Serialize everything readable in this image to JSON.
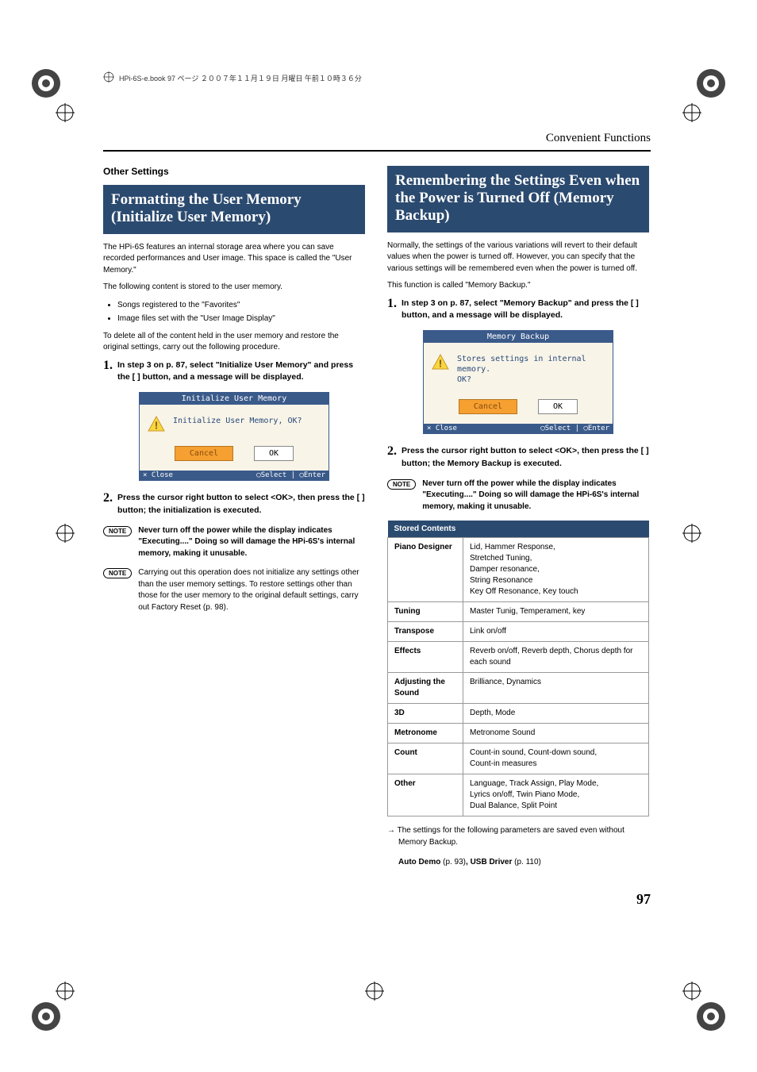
{
  "header_meta": "HPi-6S-e.book 97 ページ ２００７年１１月１９日 月曜日 午前１０時３６分",
  "breadcrumb": "Convenient Functions",
  "page_number": "97",
  "left": {
    "subheading": "Other Settings",
    "banner": "Formatting the User Memory (Initialize User Memory)",
    "p1": "The HPi-6S features an internal storage area where you can save recorded performances and User image. This space is called the \"User Memory.\"",
    "p2": "The following content is stored to the user memory.",
    "bullets": [
      "Songs registered to the \"Favorites\"",
      "Image files set with the \"User Image Display\""
    ],
    "p3": "To delete all of the content held in the user memory and restore the original settings, carry out the following procedure.",
    "step1": "In step 3 on p. 87, select \"Initialize User Memory\" and press the [     ] button, and a message will be displayed.",
    "screenshot": {
      "title": "Initialize User Memory",
      "msg": "Initialize User Memory, OK?",
      "cancel": "Cancel",
      "ok": "OK",
      "foot_left": "× Close",
      "foot_right": "◯Select | ◯Enter"
    },
    "step2": "Press the       cursor right button to select <OK>, then press the [     ] button; the initialization is executed.",
    "note1": "Never turn off the power while the display indicates \"Executing....\" Doing so will damage the HPi-6S's internal memory, making it unusable.",
    "note2": "Carrying out this operation does not initialize any settings other than the user memory settings. To restore settings other than those for the user memory to the original default settings, carry out Factory Reset (p. 98).",
    "note_label": "NOTE"
  },
  "right": {
    "banner": "Remembering the Settings Even when the Power is Turned Off (Memory Backup)",
    "p1": "Normally, the settings of the various variations will revert to their default values when the power is turned off. However, you can specify that the various settings will be remembered even when the power is turned off.",
    "p2": "This function is called \"Memory Backup.\"",
    "step1": "In step 3 on p. 87, select \"Memory Backup\" and press the [     ] button, and a message will be displayed.",
    "screenshot": {
      "title": "Memory Backup",
      "msg": "Stores settings in internal memory.\nOK?",
      "cancel": "Cancel",
      "ok": "OK",
      "foot_left": "× Close",
      "foot_right": "◯Select | ◯Enter"
    },
    "step2": "Press the       cursor right button to select <OK>, then press the [     ] button; the Memory Backup is executed.",
    "note1": "Never turn off the power while the display indicates \"Executing....\" Doing so will damage the HPi-6S's internal memory, making it unusable.",
    "note_label": "NOTE",
    "table_header": "Stored Contents",
    "table": [
      [
        "Piano Designer",
        "Lid, Hammer Response,\nStretched Tuning,\nDamper resonance,\nString Resonance\nKey Off Resonance, Key touch"
      ],
      [
        "Tuning",
        "Master Tunig, Temperament, key"
      ],
      [
        "Transpose",
        "Link on/off"
      ],
      [
        "Effects",
        "Reverb on/off, Reverb depth, Chorus depth for each sound"
      ],
      [
        "Adjusting the Sound",
        "Brilliance, Dynamics"
      ],
      [
        "3D",
        "Depth, Mode"
      ],
      [
        "Metronome",
        "Metronome Sound"
      ],
      [
        "Count",
        "Count-in sound, Count-down sound,\nCount-in measures"
      ],
      [
        "Other",
        "Language, Track Assign, Play Mode,\nLyrics on/off, Twin Piano Mode,\nDual Balance, Split Point"
      ]
    ],
    "footnote1": "→ The settings for the following parameters are saved even without Memory Backup.",
    "footnote2_a": "Auto Demo ",
    "footnote2_b": "(p. 93)",
    "footnote2_c": ", USB Driver ",
    "footnote2_d": "(p. 110)"
  }
}
